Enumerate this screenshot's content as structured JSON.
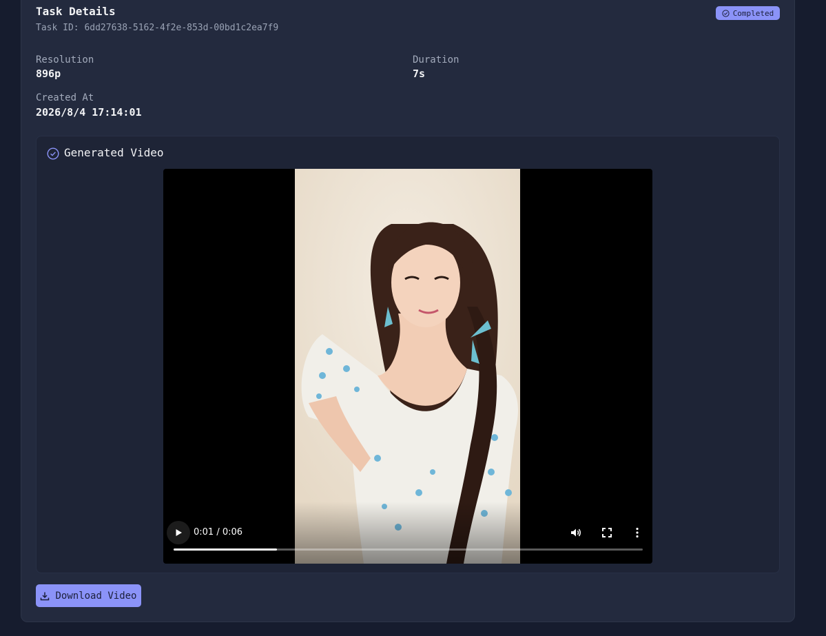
{
  "header": {
    "title": "Task Details",
    "task_id": "Task ID: 6dd27638-5162-4f2e-853d-00bd1c2ea7f9",
    "status": "Completed",
    "status_icon": "check-circle-icon"
  },
  "fields": {
    "resolution": {
      "label": "Resolution",
      "value": "896p"
    },
    "duration": {
      "label": "Duration",
      "value": "7s"
    },
    "created_at": {
      "label": "Created At",
      "value": "2026/8/4 17:14:01"
    }
  },
  "video_section": {
    "title": "Generated Video",
    "icon": "check-circle-icon"
  },
  "player": {
    "time": "0:01 / 0:06",
    "progress": 0.22,
    "icons": [
      "play-icon",
      "volume-icon",
      "fullscreen-icon",
      "more-options-icon"
    ]
  },
  "download": {
    "label": "Download Video",
    "icon": "download-icon"
  },
  "colors": {
    "accent": "#8b93f8",
    "background": "#161c2e",
    "card": "#232a3e"
  }
}
